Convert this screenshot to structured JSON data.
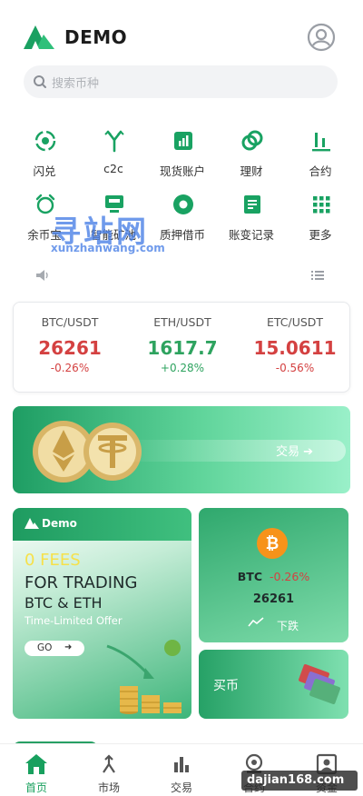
{
  "header": {
    "brand": "DEMO"
  },
  "search": {
    "placeholder": "搜索币种"
  },
  "menu": [
    {
      "label": "闪兑",
      "icon": "swap-icon"
    },
    {
      "label": "c2c",
      "icon": "fork-icon"
    },
    {
      "label": "现货账户",
      "icon": "spot-account-icon"
    },
    {
      "label": "理财",
      "icon": "rings-icon"
    },
    {
      "label": "合约",
      "icon": "contract-bars-icon"
    },
    {
      "label": "余币宝",
      "icon": "alarm-icon"
    },
    {
      "label": "智能矿池",
      "icon": "mining-pool-icon"
    },
    {
      "label": "质押借币",
      "icon": "pledge-icon"
    },
    {
      "label": "账变记录",
      "icon": "record-icon"
    },
    {
      "label": "更多",
      "icon": "more-grid-icon"
    }
  ],
  "watermark": {
    "title": "寻站网",
    "url": "xunzhanwang.com"
  },
  "tickers": [
    {
      "pair": "BTC/USDT",
      "price": "26261",
      "change": "-0.26%",
      "dir": "down"
    },
    {
      "pair": "ETH/USDT",
      "price": "1617.7",
      "change": "+0.28%",
      "dir": "up"
    },
    {
      "pair": "ETC/USDT",
      "price": "15.0611",
      "change": "-0.56%",
      "dir": "down"
    }
  ],
  "banner": {
    "button": "交易"
  },
  "promo": {
    "brand": "Demo",
    "fees": "0 FEES",
    "line1": "FOR TRADING",
    "line2": "BTC & ETH",
    "line3": "Time-Limited Offer",
    "go": "GO"
  },
  "btc_card": {
    "symbol": "BTC",
    "change": "-0.26%",
    "price": "26261",
    "trend": "下跌"
  },
  "buy_card": {
    "label": "买币"
  },
  "tabs": [
    {
      "label": "首页",
      "icon": "home-icon",
      "active": true
    },
    {
      "label": "市场",
      "icon": "market-icon",
      "active": false
    },
    {
      "label": "交易",
      "icon": "trade-icon",
      "active": false
    },
    {
      "label": "合约",
      "icon": "contract-icon",
      "active": false
    },
    {
      "label": "资金",
      "icon": "assets-icon",
      "active": false
    }
  ],
  "site_watermark": "dajian168.com",
  "colors": {
    "brand_green": "#18a05e",
    "up": "#2ea35f",
    "down": "#d44141"
  }
}
